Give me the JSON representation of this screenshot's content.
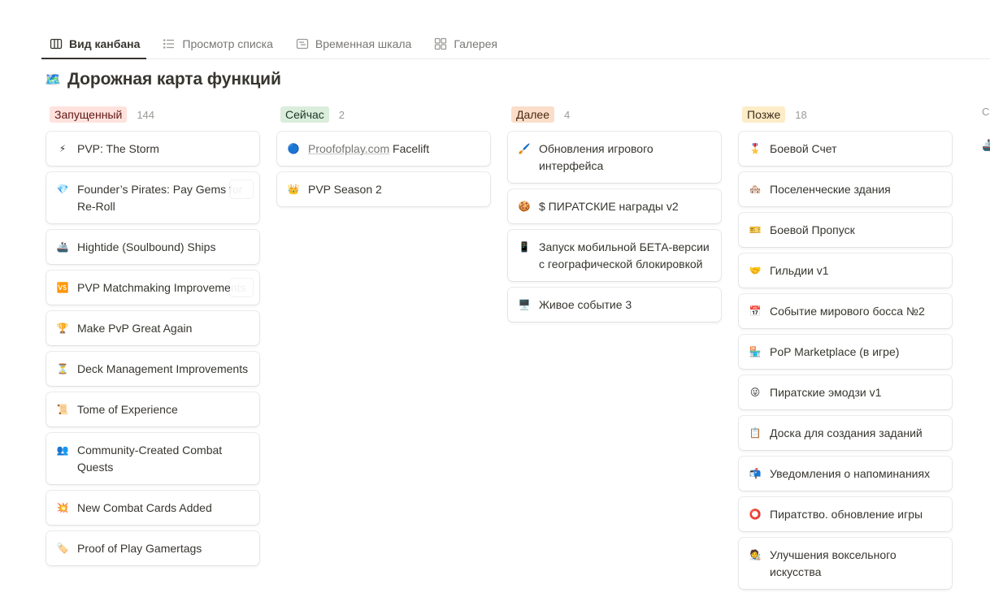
{
  "tabs": [
    {
      "label": "Вид канбана",
      "icon": "board-icon",
      "active": true
    },
    {
      "label": "Просмотр списка",
      "icon": "list-icon",
      "active": false
    },
    {
      "label": "Временная шкала",
      "icon": "timeline-icon",
      "active": false
    },
    {
      "label": "Галерея",
      "icon": "gallery-icon",
      "active": false
    }
  ],
  "page": {
    "title": "Дорожная карта функций",
    "title_icon": "🗺️"
  },
  "columns": [
    {
      "name": "Запущенный",
      "count": "144",
      "badge_bg": "#ffe2dd",
      "badge_color": "#5d1715",
      "cards": [
        {
          "label": "PVP: The Storm",
          "icon": "⚡"
        },
        {
          "label": "Founder’s Pirates: Pay Gems for Re-Roll",
          "icon": "💎"
        },
        {
          "label": "Hightide (Soulbound) Ships",
          "icon": "🚢"
        },
        {
          "label": "PVP Matchmaking Improvements",
          "icon": "🆚"
        },
        {
          "label": "Make PvP Great Again",
          "icon": "🏆"
        },
        {
          "label": "Deck Management Improvements",
          "icon": "⏳"
        },
        {
          "label": "Tome of Experience",
          "icon": "📜"
        },
        {
          "label": "Community-Created Combat Quests",
          "icon": "👥"
        },
        {
          "label": "New Combat Cards Added",
          "icon": "💥"
        },
        {
          "label": "Proof of Play Gamertags",
          "icon": "🏷️"
        }
      ]
    },
    {
      "name": "Сейчас",
      "count": "2",
      "badge_bg": "#dbeddb",
      "badge_color": "#1c3829",
      "cards": [
        {
          "label": "Facelift",
          "link": "Proofofplay.com",
          "icon": "🔵"
        },
        {
          "label": "PVP Season 2",
          "icon": "👑"
        }
      ]
    },
    {
      "name": "Далее",
      "count": "4",
      "badge_bg": "#fadec9",
      "badge_color": "#49290e",
      "cards": [
        {
          "label": "Обновления игрового интерфейса",
          "icon": "🖌️"
        },
        {
          "label": "$ ПИРАТСКИЕ награды v2",
          "icon": "🍪"
        },
        {
          "label": "Запуск мобильной БЕТА-версии с географической блокировкой",
          "icon": "📱"
        },
        {
          "label": "Живое событие 3",
          "icon": "🖥️"
        }
      ]
    },
    {
      "name": "Позже",
      "count": "18",
      "badge_bg": "#fdecc8",
      "badge_color": "#402c1b",
      "cards": [
        {
          "label": "Боевой Счет",
          "icon": "🎖️"
        },
        {
          "label": "Поселенческие здания",
          "icon": "🏘️"
        },
        {
          "label": "Боевой Пропуск",
          "icon": "🎫"
        },
        {
          "label": "Гильдии v1",
          "icon": "🤝"
        },
        {
          "label": "Событие мирового босса №2",
          "icon": "📅"
        },
        {
          "label": "PoP Marketplace (в игре)",
          "icon": "🏪"
        },
        {
          "label": "Пиратские эмодзи v1",
          "icon": "😜"
        },
        {
          "label": "Доска для создания заданий",
          "icon": "📋"
        },
        {
          "label": "Уведомления о напоминаниях",
          "icon": "📬"
        },
        {
          "label": "Пиратство. обновление игры",
          "icon": "⭕"
        },
        {
          "label": "Улучшения воксельного искусства",
          "icon": "🧑‍🎨"
        }
      ]
    }
  ],
  "partial_column": {
    "label": "С"
  }
}
